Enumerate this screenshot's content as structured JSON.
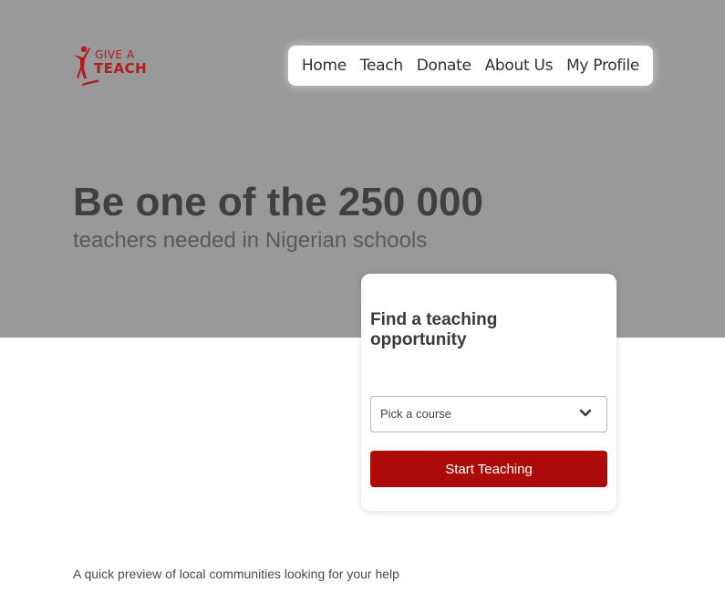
{
  "logo": {
    "line1": "GIVE A",
    "line2": "TEACH"
  },
  "nav": {
    "items": [
      {
        "label": "Home"
      },
      {
        "label": "Teach"
      },
      {
        "label": "Donate"
      },
      {
        "label": "About Us"
      },
      {
        "label": "My Profile"
      }
    ]
  },
  "hero": {
    "headline": "Be one of the 250 000",
    "subheadline": "teachers needed in Nigerian schools"
  },
  "search_card": {
    "title": "Find a teaching opportunity",
    "course_select": {
      "value": "Pick a course",
      "icon": "chevron-down-icon"
    },
    "button_label": "Start Teaching"
  },
  "preview_text": "A quick preview of local communities looking for your help",
  "colors": {
    "hero_background": "#999999",
    "brand_red": "#ad0a0a",
    "nav_background": "#ffffff"
  }
}
